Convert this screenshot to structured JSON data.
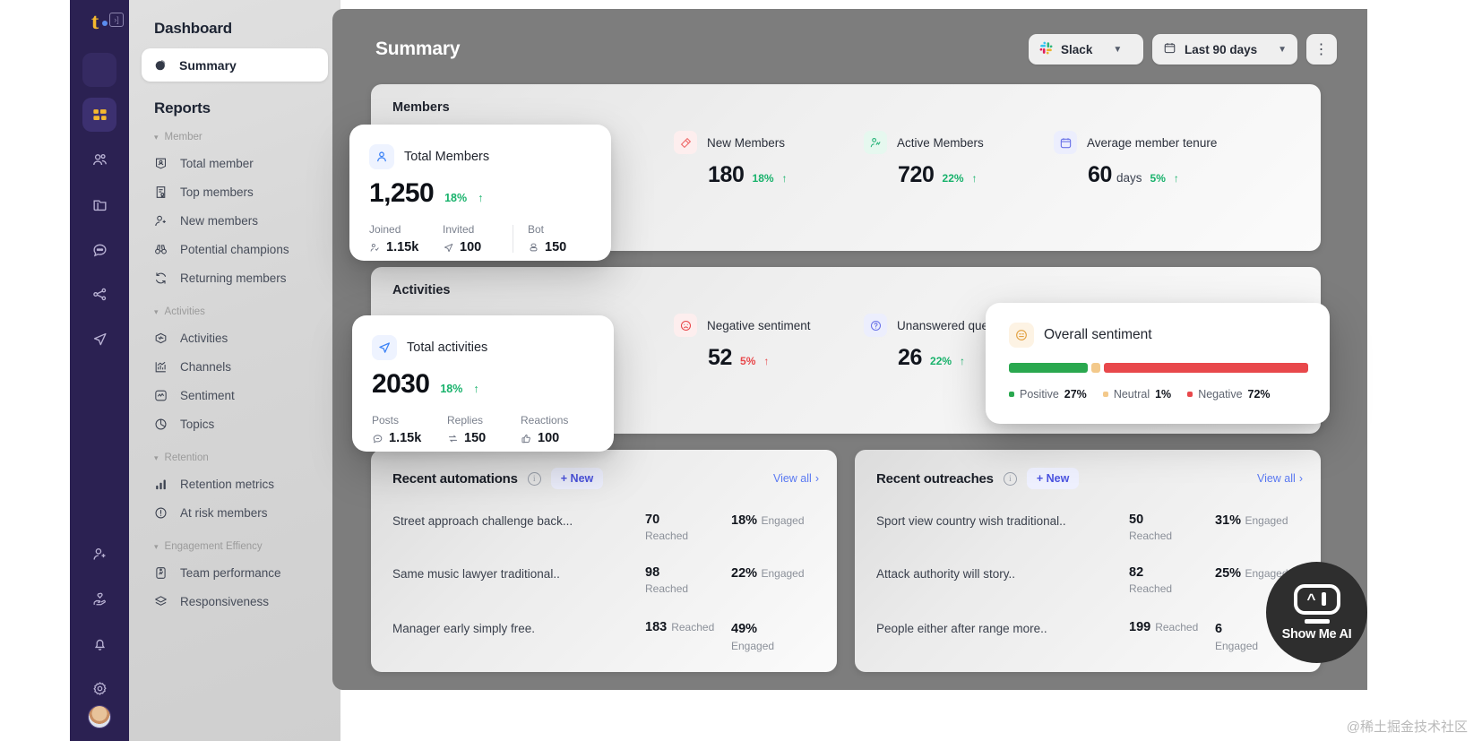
{
  "rail": {
    "logo_text": "t",
    "items": [
      {
        "name": "workspace-switcher",
        "icon": "workspace-square"
      },
      {
        "name": "dashboard",
        "icon": "grid-icon",
        "active": true
      },
      {
        "name": "members",
        "icon": "users-icon"
      },
      {
        "name": "content",
        "icon": "folder-icon"
      },
      {
        "name": "conversations",
        "icon": "chat-icon"
      },
      {
        "name": "workflows",
        "icon": "nodes-icon"
      },
      {
        "name": "outreach",
        "icon": "send-icon"
      },
      {
        "name": "invite",
        "icon": "user-plus-icon"
      },
      {
        "name": "engagement",
        "icon": "hand-heart-icon"
      },
      {
        "name": "notifications",
        "icon": "bell-icon"
      },
      {
        "name": "settings",
        "icon": "gear-icon"
      }
    ]
  },
  "sidebar": {
    "title": "Dashboard",
    "active_item": {
      "label": "Summary",
      "icon": "pie-chart-icon"
    },
    "reports_title": "Reports",
    "groups": [
      {
        "label": "Member",
        "items": [
          {
            "label": "Total member",
            "icon": "id-card-icon"
          },
          {
            "label": "Top members",
            "icon": "award-doc-icon"
          },
          {
            "label": "New members",
            "icon": "user-plus-icon"
          },
          {
            "label": "Potential champions",
            "icon": "binoculars-icon"
          },
          {
            "label": "Returning members",
            "icon": "refresh-icon"
          }
        ]
      },
      {
        "label": "Activities",
        "items": [
          {
            "label": "Activities",
            "icon": "activity-box-icon"
          },
          {
            "label": "Channels",
            "icon": "bar-chart-icon"
          },
          {
            "label": "Sentiment",
            "icon": "pulse-square-icon"
          },
          {
            "label": "Topics",
            "icon": "pie-slice-icon"
          }
        ]
      },
      {
        "label": "Retention",
        "items": [
          {
            "label": "Retention metrics",
            "icon": "bars-icon"
          },
          {
            "label": "At risk members",
            "icon": "alert-circle-icon"
          }
        ]
      },
      {
        "label": "Engagement Effiency",
        "items": [
          {
            "label": "Team performance",
            "icon": "performance-icon"
          },
          {
            "label": "Responsiveness",
            "icon": "layers-icon"
          }
        ]
      }
    ]
  },
  "header": {
    "title": "Summary",
    "source_select": {
      "label": "Slack",
      "icon": "slack-icon"
    },
    "date_select": {
      "label": "Last 90 days",
      "icon": "calendar-icon"
    },
    "more_label": "⋮"
  },
  "members_card": {
    "label": "Members",
    "metrics": [
      {
        "name": "New Members",
        "icon": "sparkle-icon",
        "value": "180",
        "unit": "",
        "delta": "18%",
        "direction": "up"
      },
      {
        "name": "Active Members",
        "icon": "user-activity-icon",
        "value": "720",
        "unit": "",
        "delta": "22%",
        "direction": "up"
      },
      {
        "name": "Average member tenure",
        "icon": "calendar-icon",
        "value": "60",
        "unit": "days",
        "delta": "5%",
        "direction": "up"
      }
    ],
    "float": {
      "title": "Total Members",
      "icon": "user-icon",
      "value": "1,250",
      "delta": "18%",
      "direction": "up",
      "breakdown": [
        {
          "key": "Joined",
          "value": "1.15k",
          "icon": "user-check-icon"
        },
        {
          "key": "Invited",
          "value": "100",
          "icon": "send-icon"
        },
        {
          "key": "Bot",
          "value": "150",
          "icon": "bot-icon"
        }
      ]
    }
  },
  "activities_card": {
    "label": "Activities",
    "metrics": [
      {
        "name": "Negative sentiment",
        "icon": "frown-icon",
        "value": "52",
        "unit": "",
        "delta": "5%",
        "direction": "up-neg"
      },
      {
        "name": "Unanswered questions",
        "icon": "question-icon",
        "value": "26",
        "unit": "",
        "delta": "22%",
        "direction": "up"
      }
    ],
    "float": {
      "title": "Total activities",
      "icon": "send-icon",
      "value": "2030",
      "delta": "18%",
      "direction": "up",
      "breakdown": [
        {
          "key": "Posts",
          "value": "1.15k",
          "icon": "message-icon"
        },
        {
          "key": "Replies",
          "value": "150",
          "icon": "reply-icon"
        },
        {
          "key": "Reactions",
          "value": "100",
          "icon": "thumb-icon"
        }
      ]
    }
  },
  "sentiment_float": {
    "title": "Overall sentiment",
    "icon": "smiley-icon",
    "segments": [
      {
        "label": "Positive",
        "value": "27%",
        "color": "#2aa84f",
        "pct": 27
      },
      {
        "label": "Neutral",
        "value": "1%",
        "color": "#f3c98b",
        "pct": 3
      },
      {
        "label": "Negative",
        "value": "72%",
        "color": "#e8484b",
        "pct": 70
      }
    ]
  },
  "automations_card": {
    "title": "Recent automations",
    "new_label": "+ New",
    "view_all": "View all",
    "columns": [
      "name",
      "Reached",
      "Engaged"
    ],
    "rows": [
      {
        "name": "Street approach challenge back...",
        "reached": "70",
        "reached_label": "Reached",
        "engaged": "18%",
        "engaged_label": "Engaged"
      },
      {
        "name": "Same music lawyer traditional..",
        "reached": "98",
        "reached_label": "Reached",
        "engaged": "22%",
        "engaged_label": "Engaged"
      },
      {
        "name": "Manager early simply free.",
        "reached": "183",
        "reached_label": "Reached",
        "engaged": "49%",
        "engaged_label": "Engaged"
      }
    ]
  },
  "outreaches_card": {
    "title": "Recent outreaches",
    "new_label": "+ New",
    "view_all": "View all",
    "rows": [
      {
        "name": "Sport view country wish traditional..",
        "reached": "50",
        "reached_label": "Reached",
        "engaged": "31%",
        "engaged_label": "Engaged"
      },
      {
        "name": "Attack authority will story..",
        "reached": "82",
        "reached_label": "Reached",
        "engaged": "25%",
        "engaged_label": "Engaged"
      },
      {
        "name": "People either after range more..",
        "reached": "199",
        "reached_label": "Reached",
        "engaged": "6",
        "engaged_label": "Engaged"
      }
    ]
  },
  "watermarks": {
    "showme": "Show Me AI",
    "juejin": "@稀土掘金技术社区"
  },
  "colors": {
    "rail_bg": "#2b2152",
    "accent_yellow": "#f5b82e",
    "positive": "#18b26b",
    "negative": "#e8484b",
    "link": "#5a79f2"
  }
}
